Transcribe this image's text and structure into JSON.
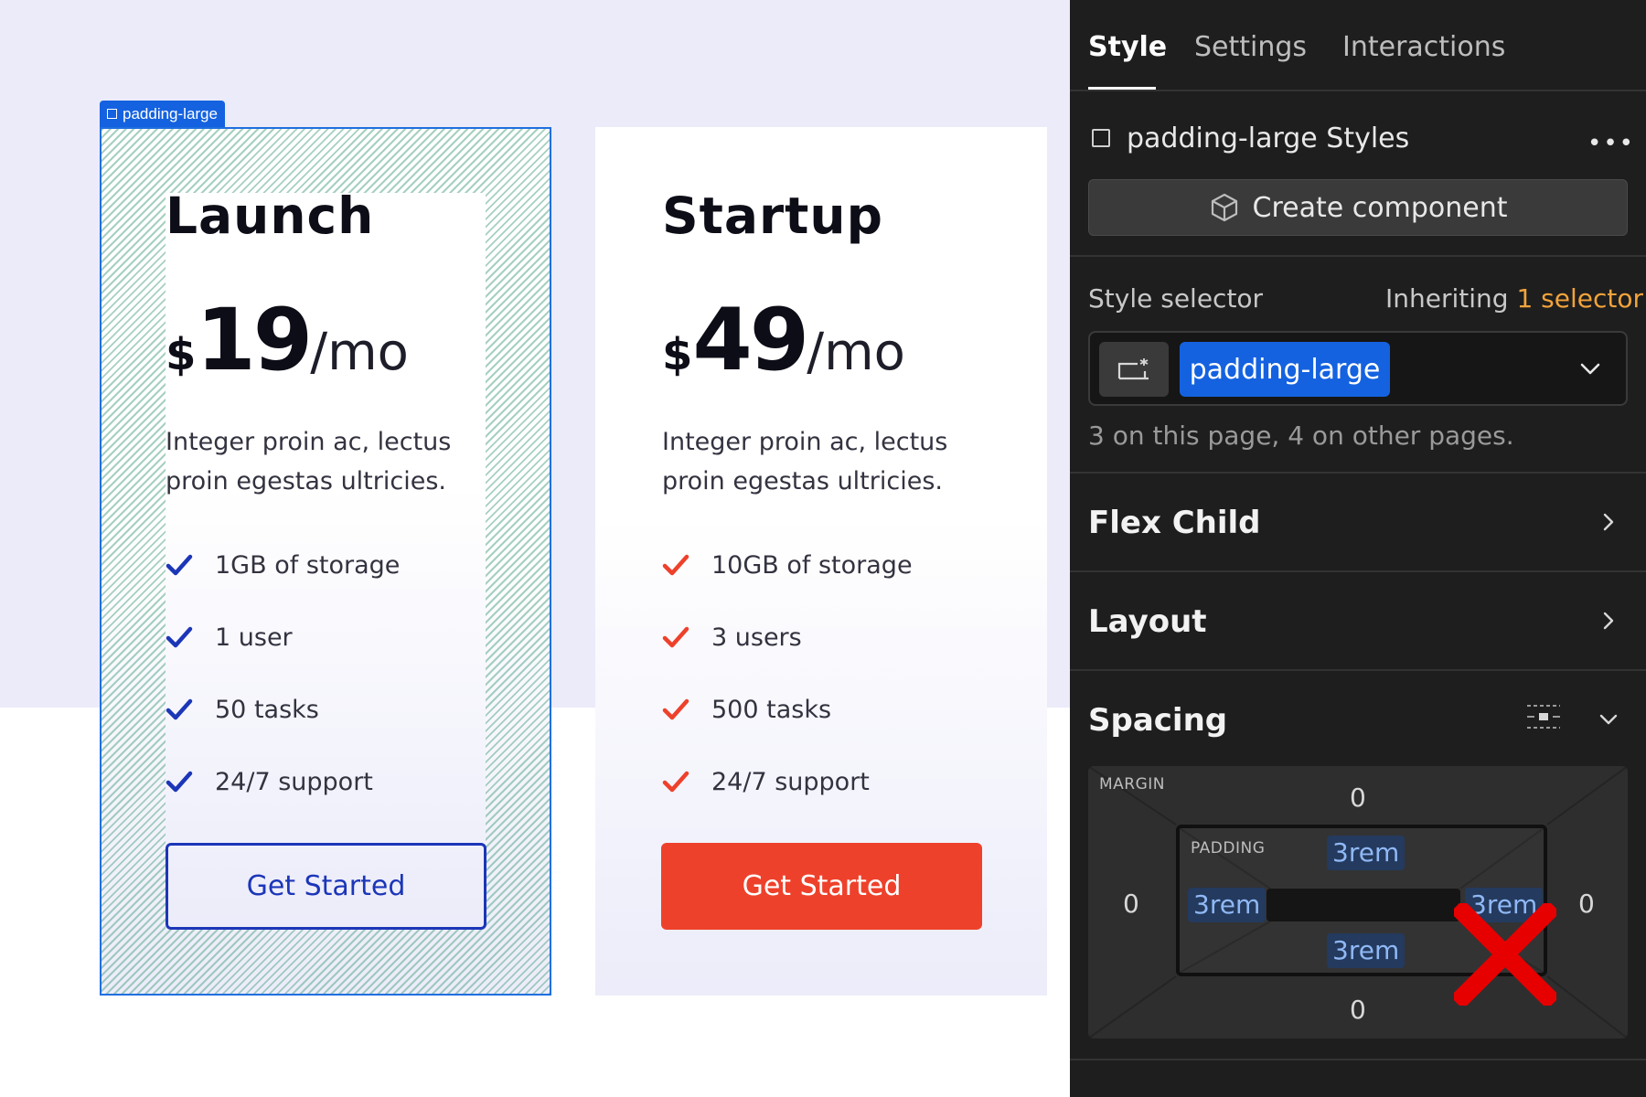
{
  "selection_tag": {
    "label": "padding-large"
  },
  "cards": [
    {
      "name": "Launch",
      "currency": "$",
      "amount": "19",
      "period": "/mo",
      "description": "Integer proin ac, lectus proin egestas ultricies.",
      "features": [
        "1GB of storage",
        "1 user",
        "50 tasks",
        "24/7 support"
      ],
      "check_color": "#1c36b8",
      "button_label": "Get Started"
    },
    {
      "name": "Startup",
      "currency": "$",
      "amount": "49",
      "period": "/mo",
      "description": "Integer proin ac, lectus proin egestas ultricies.",
      "features": [
        "10GB of storage",
        "3 users",
        "500 tasks",
        "24/7 support"
      ],
      "check_color": "#ee412b",
      "button_label": "Get Started"
    }
  ],
  "panel": {
    "tabs": [
      {
        "label": "Style",
        "active": true
      },
      {
        "label": "Settings",
        "active": false
      },
      {
        "label": "Interactions",
        "active": false
      }
    ],
    "class_title": "padding-large Styles",
    "more_icon": "more-horizontal-icon",
    "create_component_label": "Create component",
    "style_selector": {
      "label": "Style selector",
      "inheriting_prefix": "Inheriting",
      "inheriting_count": "1 selector",
      "selected_class": "padding-large",
      "usage_text": "3 on this page, 4 on other pages."
    },
    "sections": {
      "flex_child": "Flex Child",
      "layout": "Layout",
      "spacing": "Spacing"
    },
    "spacing": {
      "margin_label": "MARGIN",
      "margin_top": "0",
      "margin_right": "0",
      "margin_bottom": "0",
      "margin_left": "0",
      "padding_label": "PADDING",
      "padding_top": "3rem",
      "padding_right": "3rem",
      "padding_bottom": "3rem",
      "padding_left": "3rem"
    }
  },
  "colors": {
    "accent_blue": "#1462e0",
    "brand_red": "#ee412b",
    "inherit_orange": "#f2a33b",
    "annotation_red": "#e60000"
  }
}
